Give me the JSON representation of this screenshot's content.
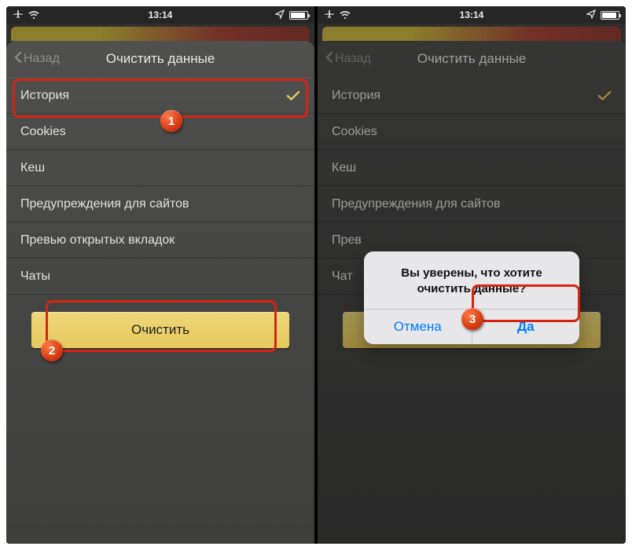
{
  "status": {
    "time": "13:14"
  },
  "sheet": {
    "back_label": "Назад",
    "title": "Очистить данные"
  },
  "items": {
    "history": "История",
    "cookies": "Cookies",
    "cache": "Кеш",
    "site_warnings": "Предупреждения для сайтов",
    "tab_previews": "Превью открытых вкладок",
    "chats": "Чаты"
  },
  "clear_button": "Очистить",
  "alert": {
    "message": "Вы уверены, что хотите очистить данные?",
    "cancel": "Отмена",
    "confirm": "Да"
  },
  "badges": {
    "b1": "1",
    "b2": "2",
    "b3": "3"
  },
  "right_truncated": {
    "tab_previews": "Прев",
    "chats": "Чат"
  },
  "colors": {
    "accent_yellow": "#e6c85e",
    "alert_blue": "#007aff",
    "annotation_red": "#d62414"
  }
}
